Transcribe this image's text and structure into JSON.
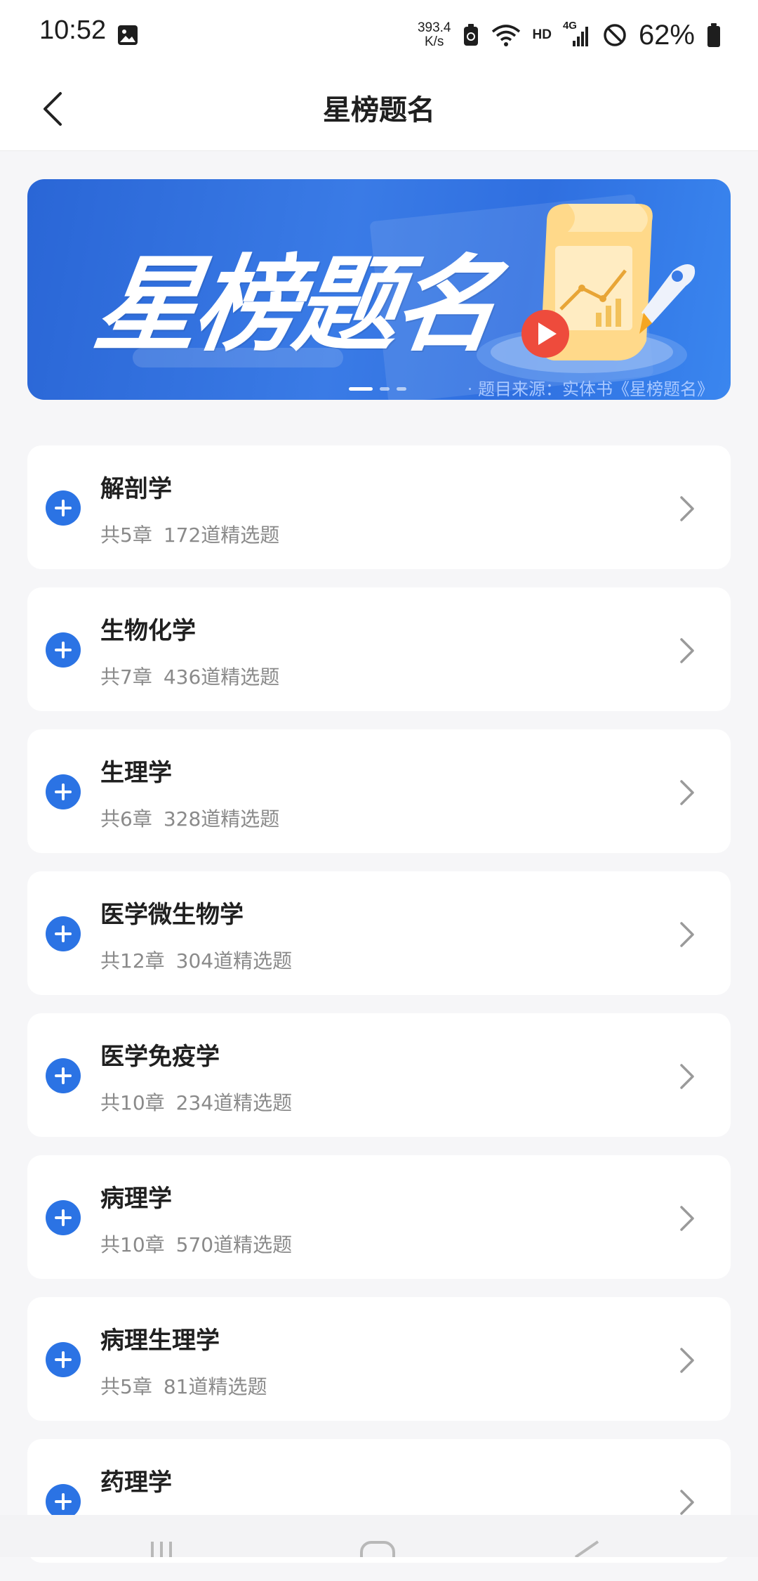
{
  "status_bar": {
    "time": "10:52",
    "speed_value": "393.4",
    "speed_unit": "K/s",
    "hd": "HD",
    "network": "4G",
    "battery": "62%"
  },
  "nav": {
    "title": "星榜题名"
  },
  "banner": {
    "title": "星榜题名",
    "source": "· 题目来源：实体书《星榜题名》"
  },
  "courses": [
    {
      "name": "解剖学",
      "chapters": "共5章",
      "questions": "172道精选题"
    },
    {
      "name": "生物化学",
      "chapters": "共7章",
      "questions": "436道精选题"
    },
    {
      "name": "生理学",
      "chapters": "共6章",
      "questions": "328道精选题"
    },
    {
      "name": "医学微生物学",
      "chapters": "共12章",
      "questions": "304道精选题"
    },
    {
      "name": "医学免疫学",
      "chapters": "共10章",
      "questions": "234道精选题"
    },
    {
      "name": "病理学",
      "chapters": "共10章",
      "questions": "570道精选题"
    },
    {
      "name": "病理生理学",
      "chapters": "共5章",
      "questions": "81道精选题"
    },
    {
      "name": "药理学",
      "chapters": "",
      "questions": ""
    }
  ],
  "colors": {
    "accent": "#2b73e4",
    "banner": "#3a7be6",
    "background": "#f6f6f8"
  }
}
